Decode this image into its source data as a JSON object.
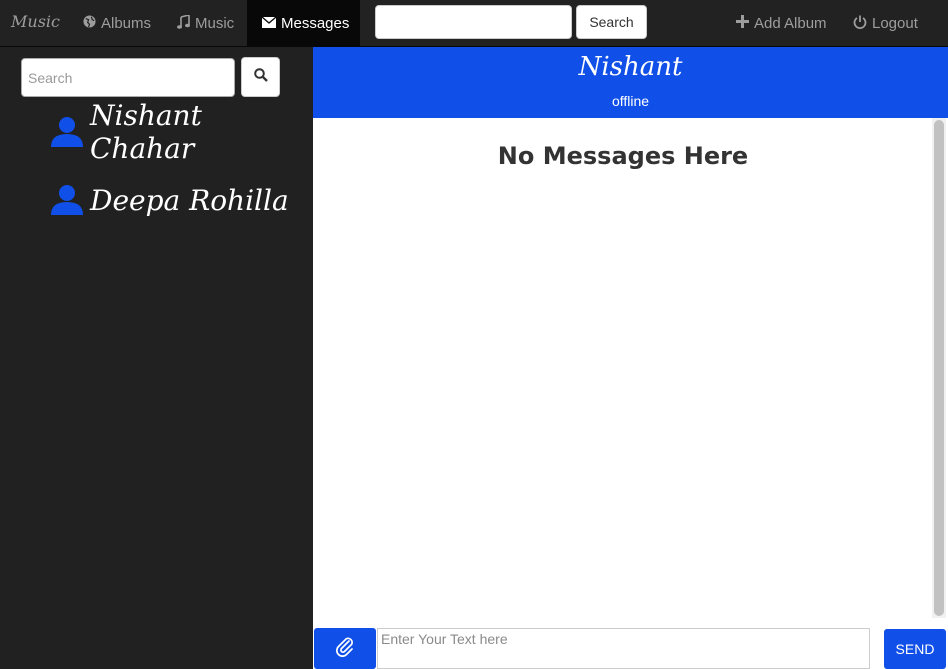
{
  "navbar": {
    "brand": "Music",
    "items": [
      {
        "label": "Albums",
        "icon": "globe-icon"
      },
      {
        "label": "Music",
        "icon": "music-note-icon"
      },
      {
        "label": "Messages",
        "icon": "envelope-icon",
        "active": true
      }
    ],
    "search_button": "Search",
    "add_album": "Add Album",
    "logout": "Logout"
  },
  "sidebar": {
    "search_placeholder": "Search",
    "contacts": [
      {
        "name": "Nishant Chahar"
      },
      {
        "name": "Deepa Rohilla"
      }
    ]
  },
  "chat": {
    "name": "Nishant",
    "status": "offline",
    "empty_text": "No Messages Here",
    "input_placeholder": "Enter Your Text here",
    "send_label": "SEND"
  },
  "colors": {
    "accent": "#1150e8",
    "navbar_bg": "#222222",
    "sidebar_bg": "#212121"
  }
}
